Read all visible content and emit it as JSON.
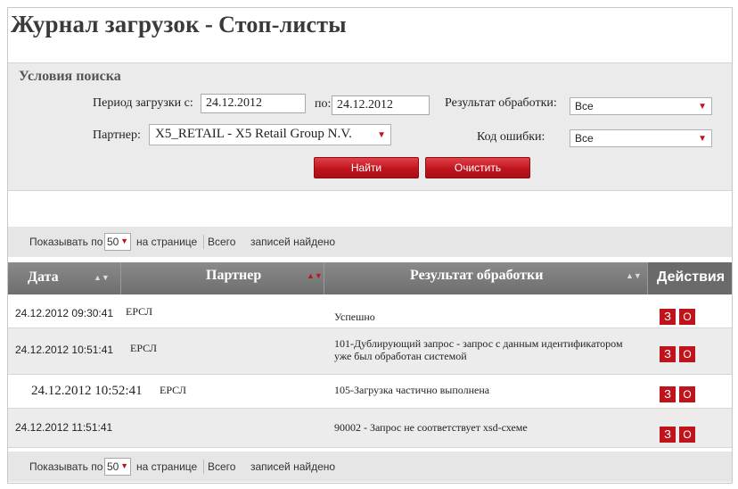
{
  "header": {
    "title_main": "Журнал загрузок",
    "title_sep": "-",
    "title_sub": "Стоп-листы"
  },
  "search": {
    "section_title": "Условия поиска",
    "period_from_label": "Период загрузки с:",
    "period_from_value": "24.12.2012",
    "period_to_label": "по:",
    "period_to_value": "24.12.2012",
    "result_label": "Результат обработки:",
    "result_value": "Все",
    "partner_label": "Партнер:",
    "partner_value": "X5_RETAIL - X5 Retail Group N.V.",
    "error_code_label": "Код ошибки:",
    "error_code_value": "Все",
    "find_button": "Найти",
    "clear_button": "Очистить"
  },
  "pager": {
    "show_by_label": "Показывать по",
    "per_page_value": "50",
    "per_page_label": "на странице",
    "total_label": "Всего",
    "records_found_label": "записей найдено"
  },
  "table": {
    "columns": {
      "date": "Дата",
      "partner": "Партнер",
      "result": "Результат обработки",
      "actions": "Действия"
    },
    "rows": [
      {
        "date": "24.12.2012 09:30:41",
        "partner": "ЕРСЛ",
        "result": "Успешно"
      },
      {
        "date": "24.12.2012 10:51:41",
        "partner": "ЕРСЛ",
        "result": "101-Дублирующий запрос - запрос с данным идентификатором уже был обработан системой"
      },
      {
        "date": "24.12.2012 10:52:41",
        "partner": "ЕРСЛ",
        "result": "105-Загрузка частично выполнена"
      },
      {
        "date": "24.12.2012  11:51:41",
        "partner": "",
        "result": "90002 - Запрос не соответствует xsd-схеме"
      }
    ],
    "action_z": "З",
    "action_o": "О"
  },
  "colors": {
    "accent": "#c0141d",
    "header_bg": "#7a7a7a",
    "panel_bg": "#ebebeb"
  }
}
